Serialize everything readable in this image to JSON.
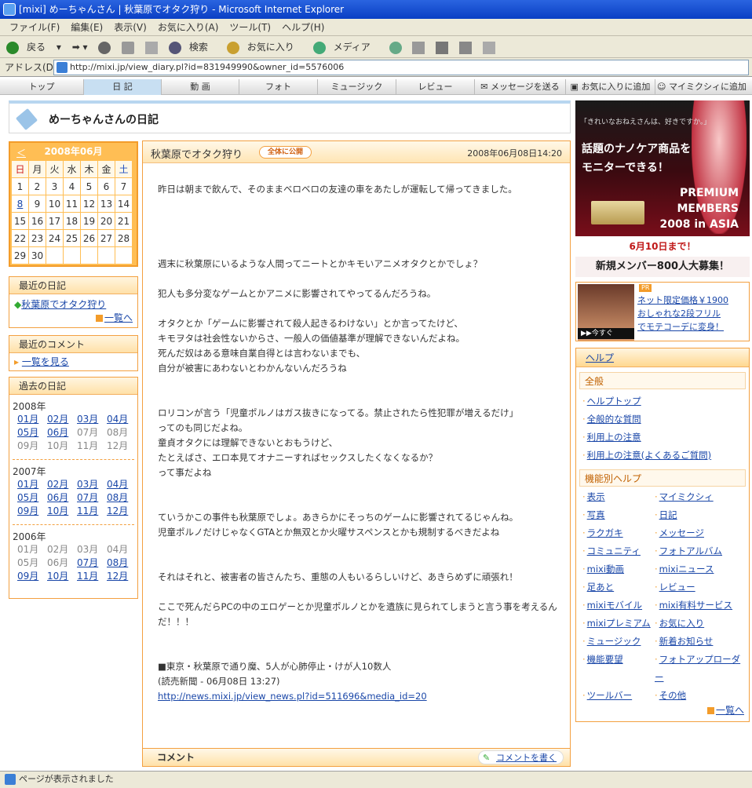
{
  "window": {
    "title": "[mixi] めーちゃんさん | 秋葉原でオタク狩り - Microsoft Internet Explorer"
  },
  "menu": [
    "ファイル(F)",
    "編集(E)",
    "表示(V)",
    "お気に入り(A)",
    "ツール(T)",
    "ヘルプ(H)"
  ],
  "toolbar": {
    "back": "戻る",
    "search": "検索",
    "favorites": "お気に入り",
    "media": "メディア"
  },
  "address": {
    "label": "アドレス(D)",
    "url": "http://mixi.jp/view_diary.pl?id=831949990&owner_id=5576006"
  },
  "nav": [
    "トップ",
    "日 記",
    "動 画",
    "フォト",
    "ミュージック",
    "レビュー",
    "メッセージを送る",
    "お気に入りに追加",
    "マイミクシィに追加"
  ],
  "header": {
    "title": "めーちゃんさんの日記"
  },
  "calendar": {
    "prev": "＜",
    "month": "2008年06月",
    "weekdays": [
      "日",
      "月",
      "火",
      "水",
      "木",
      "金",
      "土"
    ],
    "weeks": [
      [
        "1",
        "2",
        "3",
        "4",
        "5",
        "6",
        "7"
      ],
      [
        "8",
        "9",
        "10",
        "11",
        "12",
        "13",
        "14"
      ],
      [
        "15",
        "16",
        "17",
        "18",
        "19",
        "20",
        "21"
      ],
      [
        "22",
        "23",
        "24",
        "25",
        "26",
        "27",
        "28"
      ],
      [
        "29",
        "30",
        "",
        "",
        "",
        "",
        ""
      ]
    ]
  },
  "recent": {
    "title": "最近の日記",
    "item": "秋葉原でオタク狩り",
    "more": "一覧へ"
  },
  "recent_comments": {
    "title": "最近のコメント",
    "link": "一覧を見る"
  },
  "past": {
    "title": "過去の日記",
    "years": [
      {
        "year": "2008年",
        "months": [
          [
            "01月",
            "02月",
            "03月",
            "04月"
          ],
          [
            "05月",
            "06月",
            "07月",
            "08月"
          ],
          [
            "09月",
            "10月",
            "11月",
            "12月"
          ]
        ]
      },
      {
        "year": "2007年",
        "months": [
          [
            "01月",
            "02月",
            "03月",
            "04月"
          ],
          [
            "05月",
            "06月",
            "07月",
            "08月"
          ],
          [
            "09月",
            "10月",
            "11月",
            "12月"
          ]
        ]
      },
      {
        "year": "2006年",
        "months": [
          [
            "01月",
            "02月",
            "03月",
            "04月"
          ],
          [
            "05月",
            "06月",
            "07月",
            "08月"
          ],
          [
            "09月",
            "10月",
            "11月",
            "12月"
          ]
        ]
      }
    ]
  },
  "entry": {
    "title": "秋葉原でオタク狩り",
    "visibility": "全体に公開",
    "date": "2008年06月08日14:20",
    "body": "昨日は朝まで飲んで、そのままベロベロの友達の車をあたしが運転して帰ってきました。\n\n\n\n\n週末に秋葉原にいるような人間ってニートとかキモいアニメオタクとかでしょ？\n\n犯人も多分変なゲームとかアニメに影響されてやってるんだろうね。\n\nオタクとか「ゲームに影響されて殺人起きるわけない」とか言ってたけど、\nキモヲタは社会性ないからさ、一般人の価値基準が理解できないんだよね。\n死んだ奴はある意味自業自得とは言わないまでも、\n自分が被害にあわないとわかんないんだろうね\n\n\nロリコンが言う「児童ポルノはガス抜きになってる。禁止されたら性犯罪が増えるだけ」\nってのも同じだよね。\n童貞オタクには理解できないとおもうけど、\nたとえばさ、エロ本見てオナニーすればセックスしたくなくなるか？\nって事だよね\n\n\nていうかこの事件も秋葉原でしょ。あきらかにそっちのゲームに影響されてるじゃんね。\n児童ポルノだけじゃなくGTAとか無双とか火曜サスペンスとかも規制するべきだよね\n\n\nそれはそれと、被害者の皆さんたち、重態の人もいるらしいけど、あきらめずに頑張れ！\n\nここで死んだらPCの中のエロゲーとか児童ポルノとかを遺族に見られてしまうと言う事を考えるんだ！！！\n\n\n■東京・秋葉原で通り魔、5人が心肺停止・けが人10数人\n(読売新聞 - 06月08日 13:27)",
    "link": "http://news.mixi.jp/view_news.pl?id=511696&media_id=20"
  },
  "comment": {
    "label": "コメント",
    "button": "コメントを書く"
  },
  "ad": {
    "small": "「きれいなおねえさんは、好きですか。」",
    "main1": "話題のナノケア商品を",
    "main2": "モニターできる！",
    "premium1": "PREMIUM",
    "premium2": "MEMBERS",
    "premium3": "2008 in ASIA",
    "deadline": "6月10日まで！",
    "recruit": "新規メンバー800人大募集！"
  },
  "pr": {
    "tag": "PR",
    "badge": "▶▶今すぐ",
    "line1": "ネット限定価格￥1900",
    "line2": "おしゃれな2段フリル",
    "line3": "でモテコーデに変身！"
  },
  "help": {
    "title": "ヘルプ",
    "general": "全般",
    "general_links": [
      "ヘルプトップ",
      "全般的な質問",
      "利用上の注意",
      "利用上の注意(よくあるご質問)"
    ],
    "feature": "機能別ヘルプ",
    "feature_links": [
      "表示",
      "マイミクシィ",
      "写真",
      "日記",
      "ラクガキ",
      "メッセージ",
      "コミュニティ",
      "フォトアルバム",
      "mixi動画",
      "mixiニュース",
      "足あと",
      "レビュー",
      "mixiモバイル",
      "mixi有料サービス",
      "mixiプレミアム",
      "お気に入り",
      "ミュージック",
      "新着お知らせ",
      "機能要望",
      "フォトアップローダー",
      "ツールバー",
      "その他"
    ],
    "more": "一覧へ"
  },
  "status": {
    "text": "ページが表示されました"
  }
}
